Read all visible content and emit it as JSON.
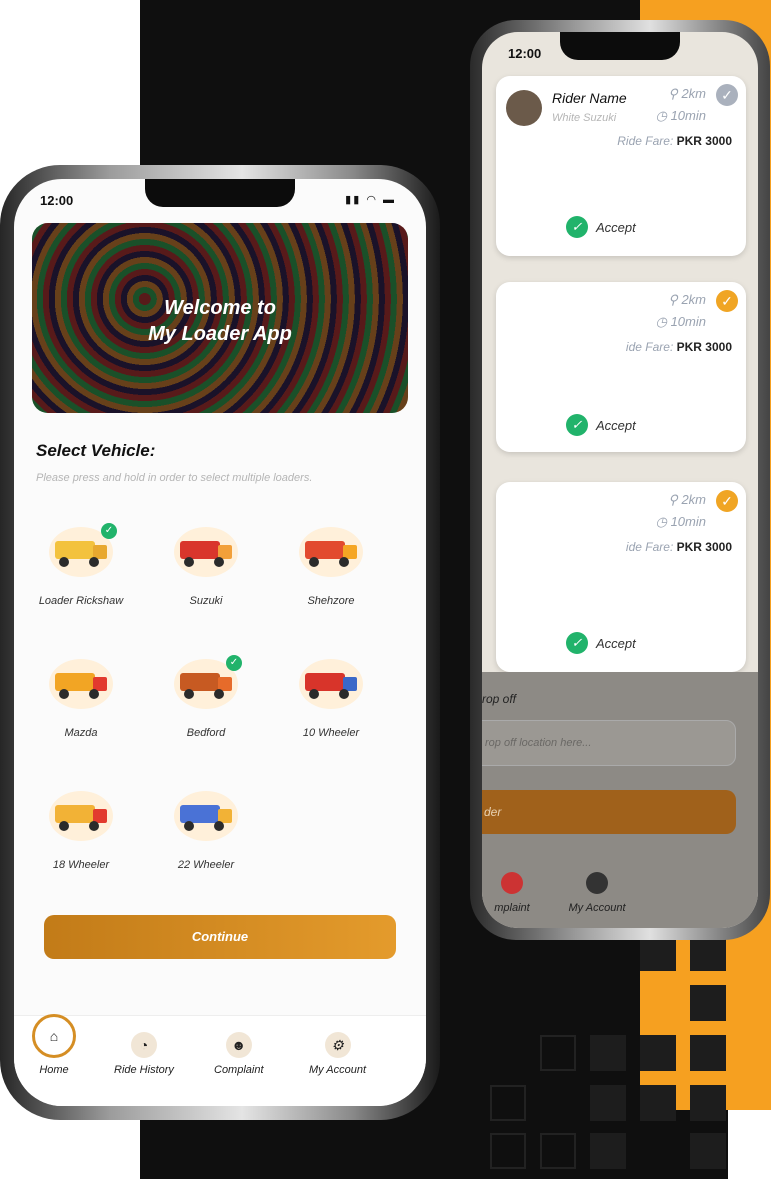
{
  "colors": {
    "accent": "#f0a524",
    "dark": "#0f0f0f",
    "green": "#21b36b"
  },
  "back_phone": {
    "status_time": "12:00",
    "rider_name": "Rider Name",
    "vehicle": "White Suzuki",
    "cards": [
      {
        "distance": "2km",
        "time": "10min",
        "fare_label": "Ride Fare:",
        "fare": "PKR 3000",
        "accept": "Accept"
      },
      {
        "distance": "2km",
        "time": "10min",
        "fare_label": "ide Fare:",
        "fare": "PKR 3000",
        "accept": "Accept"
      },
      {
        "distance": "2km",
        "time": "10min",
        "fare_label": "ide Fare:",
        "fare": "PKR 3000",
        "accept": "Accept"
      }
    ],
    "drop_label": "rop off",
    "drop_placeholder": "rop off location here...",
    "button_fragment": "der",
    "tabs": [
      "mplaint",
      "My Account"
    ]
  },
  "front_phone": {
    "status_time": "12:00",
    "banner_line1": "Welcome to",
    "banner_line2": "My Loader App",
    "select_title": "Select Vehicle:",
    "select_subtitle": "Please press and hold in order to select multiple loaders.",
    "vehicles": [
      {
        "label": "Loader Rickshaw",
        "icon": "rickshaw-icon",
        "selected": true
      },
      {
        "label": "Suzuki",
        "icon": "suzuki-icon",
        "selected": false
      },
      {
        "label": "Shehzore",
        "icon": "shehzore-icon",
        "selected": false
      },
      {
        "label": "Mazda",
        "icon": "mazda-icon",
        "selected": false
      },
      {
        "label": "Bedford",
        "icon": "bedford-icon",
        "selected": true
      },
      {
        "label": "10 Wheeler",
        "icon": "ten-wheeler-icon",
        "selected": false
      },
      {
        "label": "18 Wheeler",
        "icon": "eighteen-wheeler-icon",
        "selected": false
      },
      {
        "label": "22 Wheeler",
        "icon": "twentytwo-wheeler-icon",
        "selected": false
      }
    ],
    "continue_label": "Continue",
    "tabs": {
      "home": "Home",
      "ride_history": "Ride History",
      "complaint": "Complaint",
      "my_account": "My Account"
    }
  }
}
